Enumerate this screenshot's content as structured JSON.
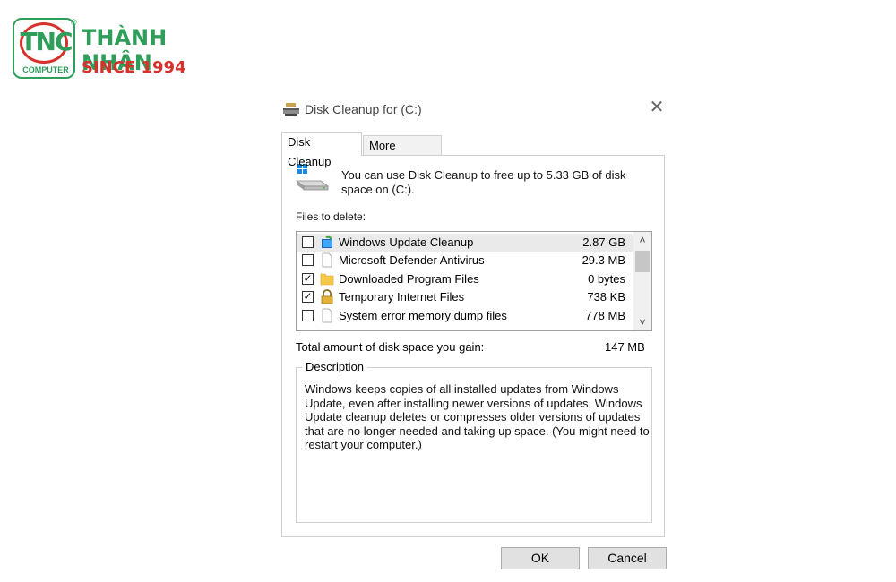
{
  "logo": {
    "badge_text": "TNC",
    "badge_sub": "COMPUTER",
    "registered": "®",
    "name": "THÀNH NHÂN",
    "tagline": "SINCE 1994",
    "colors": {
      "green": "#2f9e5a",
      "red": "#d5322a"
    }
  },
  "dialog": {
    "title": "Disk Cleanup for  (C:)",
    "close_glyph": "✕",
    "tabs": [
      {
        "label": "Disk Cleanup",
        "active": true
      },
      {
        "label": "More Options",
        "active": false
      }
    ],
    "info": "You can use Disk Cleanup to free up to 5.33 GB of disk space on  (C:).",
    "files_label": "Files to delete:",
    "files": [
      {
        "name": "Windows Update Cleanup",
        "size": "2.87 GB",
        "checked": false,
        "icon": "windows-update-icon",
        "selected": true
      },
      {
        "name": "Microsoft Defender Antivirus",
        "size": "29.3 MB",
        "checked": false,
        "icon": "blank-file-icon",
        "selected": false
      },
      {
        "name": "Downloaded Program Files",
        "size": "0 bytes",
        "checked": true,
        "icon": "folder-icon",
        "selected": false
      },
      {
        "name": "Temporary Internet Files",
        "size": "738 KB",
        "checked": true,
        "icon": "lock-icon",
        "selected": false
      },
      {
        "name": "System error memory dump files",
        "size": "778 MB",
        "checked": false,
        "icon": "blank-file-icon",
        "selected": false
      }
    ],
    "scroll_up": "˄",
    "scroll_down": "˅",
    "total_label": "Total amount of disk space you gain:",
    "total_value": "147 MB",
    "description_title": "Description",
    "description": "Windows keeps copies of all installed updates from Windows Update, even after installing newer versions of updates. Windows Update cleanup deletes or compresses older versions of updates that are no longer needed and taking up space. (You might need to restart your computer.)",
    "ok_label": "OK",
    "cancel_label": "Cancel",
    "check_glyph": "✓"
  }
}
